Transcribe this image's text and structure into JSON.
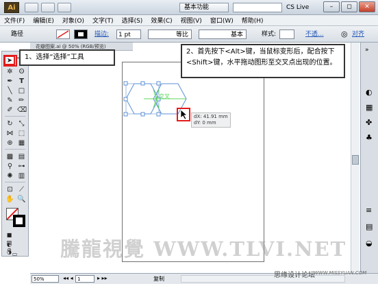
{
  "app": {
    "logo": "Ai",
    "workspace": "基本功能",
    "cs_live": "CS Live"
  },
  "menu": [
    "文件(F)",
    "编辑(E)",
    "对象(O)",
    "文字(T)",
    "选择(S)",
    "效果(C)",
    "视图(V)",
    "窗口(W)",
    "帮助(H)"
  ],
  "controlbar": {
    "path_label": "路径",
    "stroke_label": "描边:",
    "stroke_value": "1 pt",
    "profile_label": "等比",
    "brush_label": "基本",
    "style_label": "样式:",
    "opacity_label": "不透...",
    "align_label": "对齐"
  },
  "document": {
    "tab": "花瓣图案.ai @ 50% (RGB/预览)"
  },
  "canvas": {
    "smart_guide": "交叉",
    "readout_dx": "dX: 41.91 mm",
    "readout_dy": "dY: 0 mm"
  },
  "callouts": {
    "step1": "1、选择“选择”工具",
    "step2": "2、首先按下<Alt>键，当鼠标变形后，配合按下<Shift>键，水平拖动图形至交叉点出现的位置。"
  },
  "statusbar": {
    "zoom": "50%",
    "page": "1",
    "mode": "复制"
  },
  "watermark": "騰龍視覺 WWW.TLVI.NET",
  "forum": {
    "name": "思缘设计论坛",
    "url": "WWW.MISSYUAN.COM"
  },
  "colors": {
    "accent": "#e31b1b",
    "guide": "#58d558",
    "shape_stroke": "#5b8fd6"
  }
}
